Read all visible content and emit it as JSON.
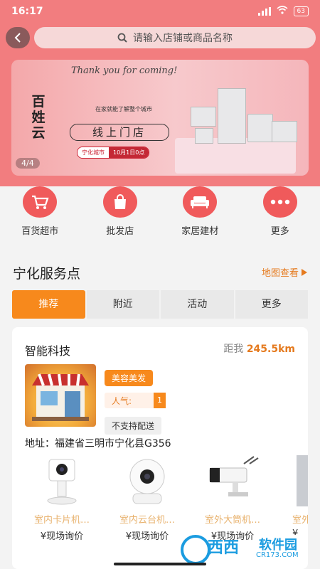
{
  "status": {
    "time": "16:17",
    "battery": "63"
  },
  "search": {
    "placeholder": "请输入店铺或商品名称"
  },
  "banner": {
    "tagline": "Thank you for coming!",
    "brand": "百姓云",
    "subtitle": "在家就能了解整个城市",
    "headline": "线上门店",
    "city": "宁化城市",
    "date": "10月1日0点",
    "index": "4/4"
  },
  "categories": [
    {
      "label": "百货超市",
      "icon": "cart-icon"
    },
    {
      "label": "批发店",
      "icon": "shopping-bag-icon"
    },
    {
      "label": "家居建材",
      "icon": "sofa-icon"
    },
    {
      "label": "更多",
      "icon": "more-dots-icon"
    }
  ],
  "service": {
    "title": "宁化服务点",
    "map_link": "地图查看"
  },
  "tabs": [
    "推荐",
    "附近",
    "活动",
    "更多"
  ],
  "shop": {
    "name": "智能科技",
    "distance_label": "距我",
    "distance": "245.5km",
    "tag_category": "美容美发",
    "popularity_label": "人气:",
    "popularity": "1",
    "delivery": "不支持配送",
    "address": "地址：福建省三明市宁化县G356",
    "products": [
      {
        "name": "室内卡片机…",
        "price": "¥现场询价"
      },
      {
        "name": "室内云台机…",
        "price": "¥现场询价"
      },
      {
        "name": "室外大筒机…",
        "price": "¥现场询价"
      },
      {
        "name": "室外",
        "price": "¥"
      }
    ]
  },
  "watermark": {
    "brand": "西西",
    "name": "软件园",
    "url": "CR173.COM"
  },
  "colors": {
    "accent": "#f7891c",
    "brand_red": "#f05a5b",
    "top_bg": "#f27d7f"
  }
}
